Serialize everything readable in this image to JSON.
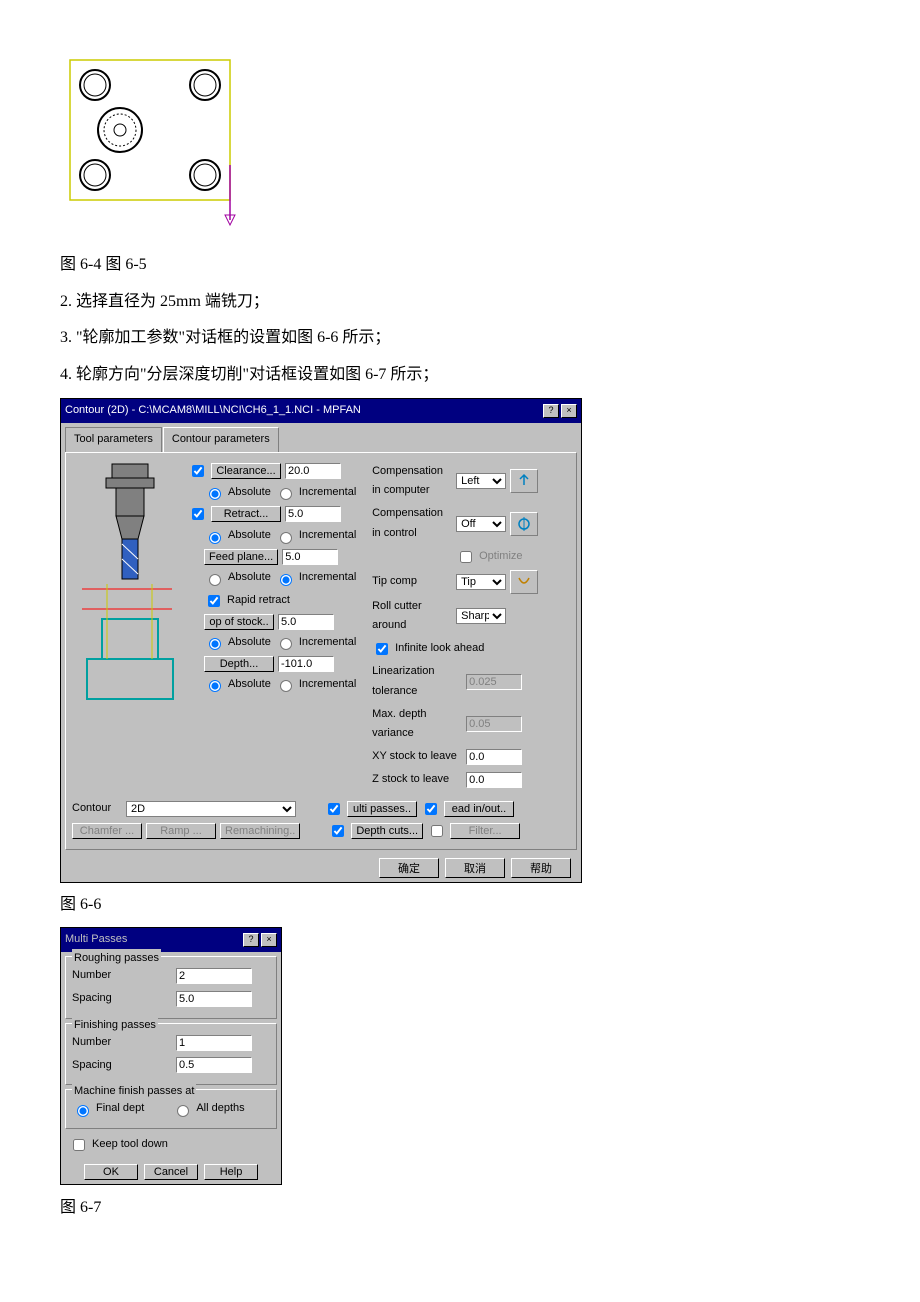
{
  "fig1_caption": "图 6-4 图 6-5",
  "line2": "2. 选择直径为 25mm 端铣刀；",
  "line3": "3. \"轮廓加工参数\"对话框的设置如图 6-6 所示；",
  "line4": "4. 轮廓方向\"分层深度切削\"对话框设置如图 6-7 所示；",
  "d1": {
    "title": "Contour (2D) - C:\\MCAM8\\MILL\\NCI\\CH6_1_1.NCI - MPFAN",
    "tab1": "Tool parameters",
    "tab2": "Contour parameters",
    "clearance_btn": "Clearance...",
    "clearance_val": "20.0",
    "abs": "Absolute",
    "inc": "Incremental",
    "retract_btn": "Retract...",
    "retract_val": "5.0",
    "feed_btn": "Feed plane...",
    "feed_val": "5.0",
    "rapid": "Rapid retract",
    "top_btn": "op of stock..",
    "top_val": "5.0",
    "depth_btn": "Depth...",
    "depth_val": "-101.0",
    "comp_comp": "Compensation in computer",
    "comp_comp_v": "Left",
    "comp_ctrl": "Compensation in control",
    "comp_ctrl_v": "Off",
    "optimize": "Optimize",
    "tip": "Tip comp",
    "tip_v": "Tip",
    "roll": "Roll cutter around",
    "roll_v": "Sharp",
    "inf": "Infinite look ahead",
    "lin": "Linearization tolerance",
    "lin_v": "0.025",
    "maxd": "Max. depth variance",
    "maxd_v": "0.05",
    "xy": "XY stock to leave",
    "xy_v": "0.0",
    "z": "Z stock to leave",
    "z_v": "0.0",
    "contour_lbl": "Contour",
    "contour_v": "2D",
    "multi": "ulti passes..",
    "lead": "ead in/out..",
    "depthcuts": "Depth cuts...",
    "filter": "Filter...",
    "chamfer": "Chamfer ...",
    "ramp": "Ramp ...",
    "remach": "Remachining..",
    "ok": "确定",
    "cancel": "取消",
    "help": "帮助"
  },
  "cap66": "图 6-6",
  "d2": {
    "title": "Multi Passes",
    "rough": "Roughing passes",
    "finish": "Finishing passes",
    "number": "Number",
    "spacing": "Spacing",
    "r_num": "2",
    "r_sp": "5.0",
    "f_num": "1",
    "f_sp": "0.5",
    "mach": "Machine finish passes at",
    "final": "Final dept",
    "all": "All depths",
    "keep": "Keep tool down",
    "ok": "OK",
    "cancel": "Cancel",
    "help": "Help"
  },
  "cap67": "图 6-7"
}
